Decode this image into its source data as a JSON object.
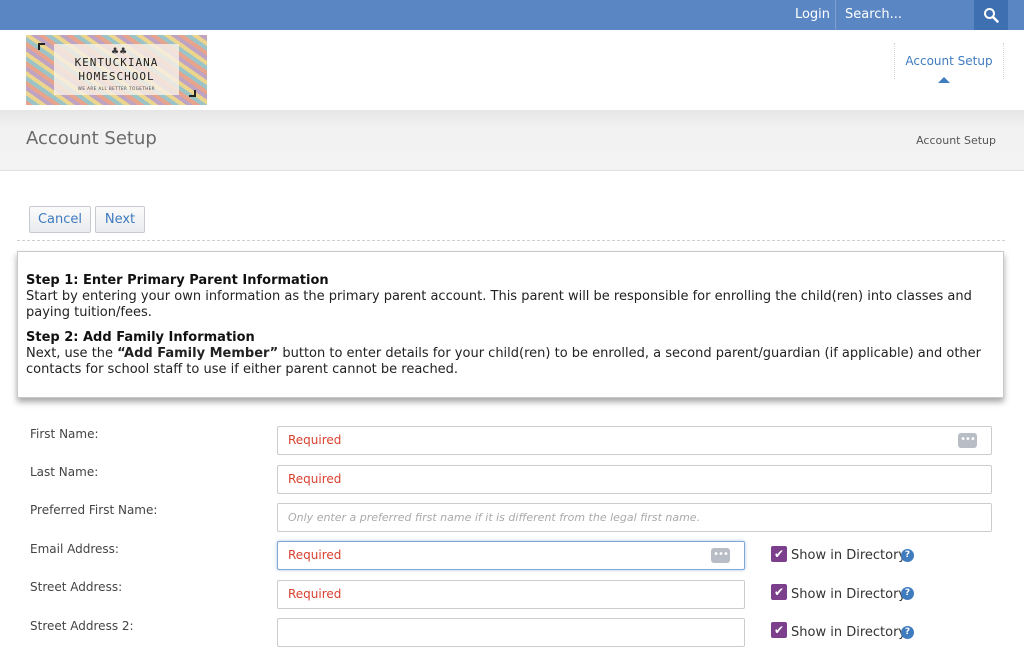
{
  "topbar": {
    "login_label": "Login",
    "search_placeholder": "Search...",
    "search_icon": "search-icon"
  },
  "logo": {
    "line1": "KENTUCKIANA",
    "line2": "HOMESCHOOL",
    "tagline": "WE ARE ALL BETTER TOGETHER"
  },
  "nav": {
    "active_item": "Account Setup"
  },
  "page": {
    "title": "Account Setup",
    "breadcrumb": "Account Setup"
  },
  "actions": {
    "cancel_label": "Cancel",
    "next_label": "Next"
  },
  "instructions": {
    "step1_heading": "Step 1: Enter Primary Parent Information",
    "step1_text": "Start by entering your own information as the primary parent account. This parent will be responsible for enrolling the child(ren) into classes and paying tuition/fees.",
    "step2_heading": "Step 2: Add Family Information",
    "step2_prefix": "Next, use the ",
    "step2_button_ref": "“Add Family Member”",
    "step2_suffix": " button to enter details for your child(ren) to be enrolled, a second parent/guardian (if applicable) and other contacts for school staff to use if either parent cannot be reached."
  },
  "form": {
    "first_name": {
      "label": "First Name:",
      "value": "Required"
    },
    "last_name": {
      "label": "Last Name:",
      "value": "Required"
    },
    "preferred_first_name": {
      "label": "Preferred First Name:",
      "placeholder": "Only enter a preferred first name if it is different from the legal first name."
    },
    "email": {
      "label": "Email Address:",
      "value": "Required",
      "directory_label": "Show in Directory",
      "show_in_directory": true
    },
    "street": {
      "label": "Street Address:",
      "value": "Required",
      "directory_label": "Show in Directory",
      "show_in_directory": true
    },
    "street2": {
      "label": "Street Address 2:",
      "value": "",
      "directory_label": "Show in Directory",
      "show_in_directory": true
    }
  },
  "colors": {
    "topbar": "#5a87c4",
    "link": "#3f7bbf",
    "required_text": "#d9412f",
    "checkbox": "#7b3f8c"
  }
}
